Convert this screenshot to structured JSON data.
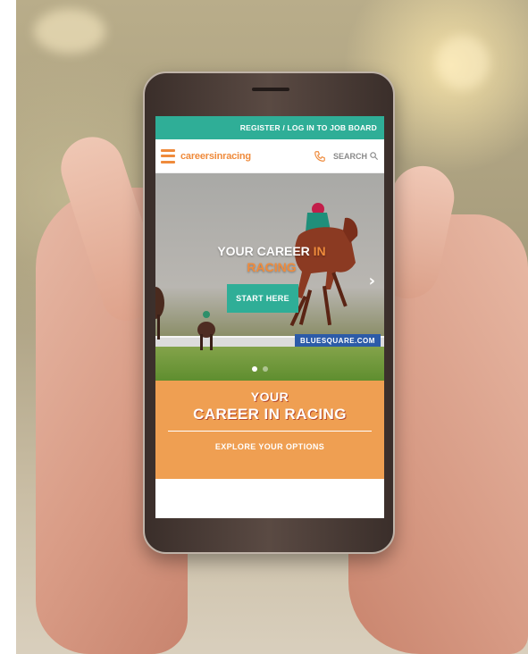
{
  "site": {
    "topbar_link": "REGISTER / LOG IN TO JOB BOARD",
    "logo_text": "careersinracing",
    "search_label": "SEARCH"
  },
  "hero": {
    "title_part1": "YOUR CAREER",
    "title_accent1": " IN",
    "title_accent2": "RACING",
    "cta_label": "START HERE",
    "banner_text": "BLUESQUARE.COM",
    "next_icon": "chevron-right-icon",
    "slides": 2,
    "active_slide": 1
  },
  "promo": {
    "line1": "YOUR",
    "line2": "CAREER IN RACING",
    "link_label": "EXPLORE YOUR OPTIONS"
  },
  "colors": {
    "teal": "#2fae97",
    "orange": "#ef8b3c",
    "promo_orange": "#ef9f52"
  }
}
